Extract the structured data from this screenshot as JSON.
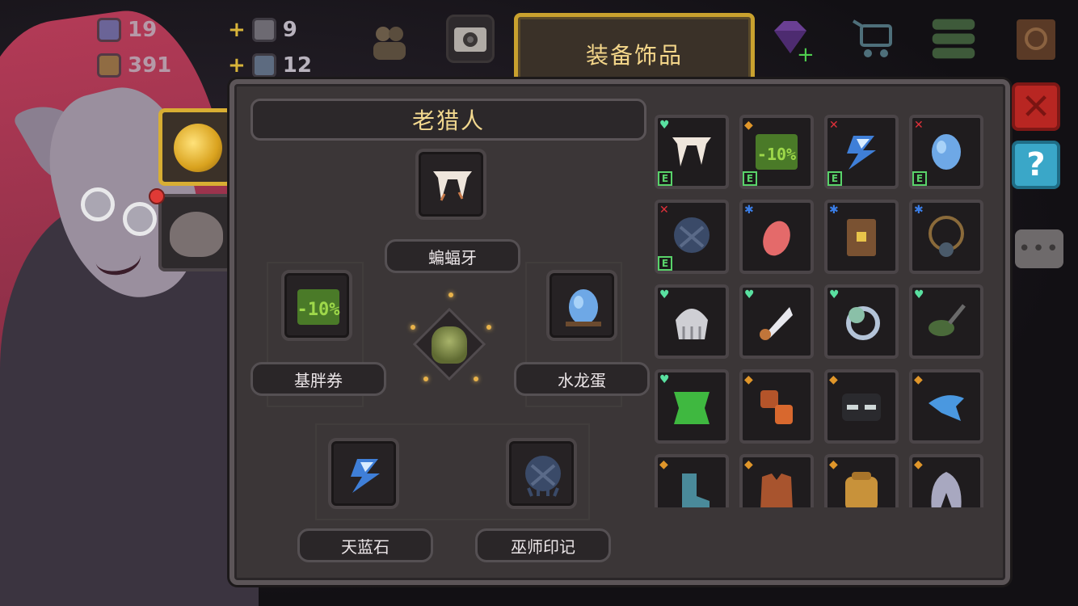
{
  "hud": {
    "resource1": {
      "icon": "gem-icon",
      "value": "19"
    },
    "resource2": {
      "icon": "coin-icon",
      "value": "391"
    },
    "bonus1": {
      "icon": "backpack-icon",
      "value": "9"
    },
    "bonus2": {
      "icon": "backpack-icon",
      "value": "12"
    },
    "plus": "+"
  },
  "title_tab": "装备饰品",
  "character_name": "老猎人",
  "slots": {
    "top": {
      "label": "蝙蝠牙",
      "icon": "bat-fang-icon"
    },
    "left": {
      "label": "基胖券",
      "icon": "coupon-icon"
    },
    "right": {
      "label": "水龙蛋",
      "icon": "water-dragon-egg-icon"
    },
    "bottom_left": {
      "label": "天蓝石",
      "icon": "sky-blue-stone-icon"
    },
    "bottom_right": {
      "label": "巫师印记",
      "icon": "wizard-mark-icon"
    }
  },
  "inventory_badges": {
    "equipped": "E",
    "heart": "♥",
    "shield": "◆",
    "sword": "✕",
    "star": "✱"
  },
  "inventory": [
    {
      "icon": "bat-fang-icon",
      "badge": "heart",
      "equipped": true
    },
    {
      "icon": "coupon-icon",
      "badge": "shield",
      "equipped": true
    },
    {
      "icon": "sky-blue-stone-icon",
      "badge": "sword",
      "equipped": true
    },
    {
      "icon": "water-dragon-egg-icon",
      "badge": "sword",
      "equipped": true
    },
    {
      "icon": "wizard-mark-icon",
      "badge": "sword",
      "equipped": true
    },
    {
      "icon": "meat-icon",
      "badge": "star",
      "equipped": false
    },
    {
      "icon": "scroll-box-icon",
      "badge": "star",
      "equipped": false
    },
    {
      "icon": "necklace-icon",
      "badge": "star",
      "equipped": false
    },
    {
      "icon": "skull-helm-icon",
      "badge": "heart",
      "equipped": false
    },
    {
      "icon": "feather-quill-icon",
      "badge": "heart",
      "equipped": false
    },
    {
      "icon": "magic-ring-icon",
      "badge": "heart",
      "equipped": false
    },
    {
      "icon": "frying-pan-icon",
      "badge": "heart",
      "equipped": false
    },
    {
      "icon": "green-cloth-icon",
      "badge": "heart",
      "equipped": false
    },
    {
      "icon": "leather-gloves-icon",
      "badge": "shield",
      "equipped": false
    },
    {
      "icon": "dark-mask-icon",
      "badge": "shield",
      "equipped": false
    },
    {
      "icon": "blue-bird-icon",
      "badge": "shield",
      "equipped": false
    },
    {
      "icon": "boot-icon",
      "badge": "shield",
      "equipped": false
    },
    {
      "icon": "leather-vest-icon",
      "badge": "shield",
      "equipped": false
    },
    {
      "icon": "backpack-icon",
      "badge": "shield",
      "equipped": false
    },
    {
      "icon": "hood-icon",
      "badge": "shield",
      "equipped": false
    }
  ],
  "buttons": {
    "close": "✕",
    "help": "?",
    "chat": "•••"
  },
  "colors": {
    "gold": "#d8ae33",
    "heart": "#59e0a0",
    "shield": "#e0962a",
    "sword": "#e0303a",
    "star": "#3a7ee8"
  }
}
